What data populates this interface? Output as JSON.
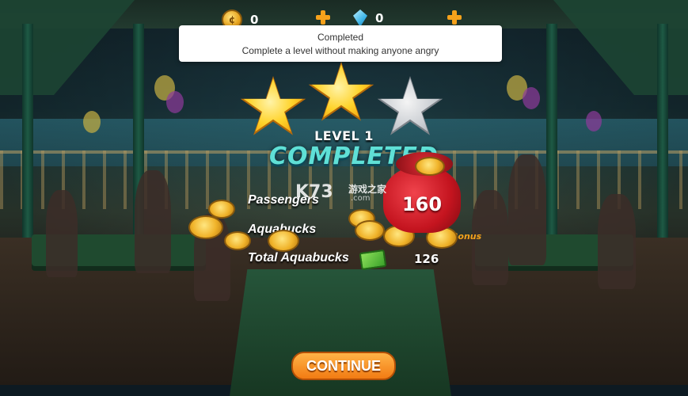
{
  "hud": {
    "coins": "0",
    "gems": "0"
  },
  "notification": {
    "title": "Completed",
    "description": "Complete a level without making anyone angry"
  },
  "stars": {
    "earned": 2,
    "total": 3
  },
  "level": {
    "label": "LEVEL 1",
    "status": "COMPLETED"
  },
  "results": {
    "passengers_label": "Passengers",
    "aquabucks_label": "Aquabucks",
    "total_aquabucks_label": "Total Aquabucks",
    "total_aquabucks_value": "126",
    "bag_value": "160",
    "bonus_label": "Bonus"
  },
  "watermark": {
    "brand": "K73",
    "cn": "游戏之家",
    "domain": ".com"
  },
  "continue_label": "CONTINUE",
  "colors": {
    "accent": "#f27b13",
    "completed_text": "#5fe0d6",
    "gold": "#ffd32a"
  }
}
